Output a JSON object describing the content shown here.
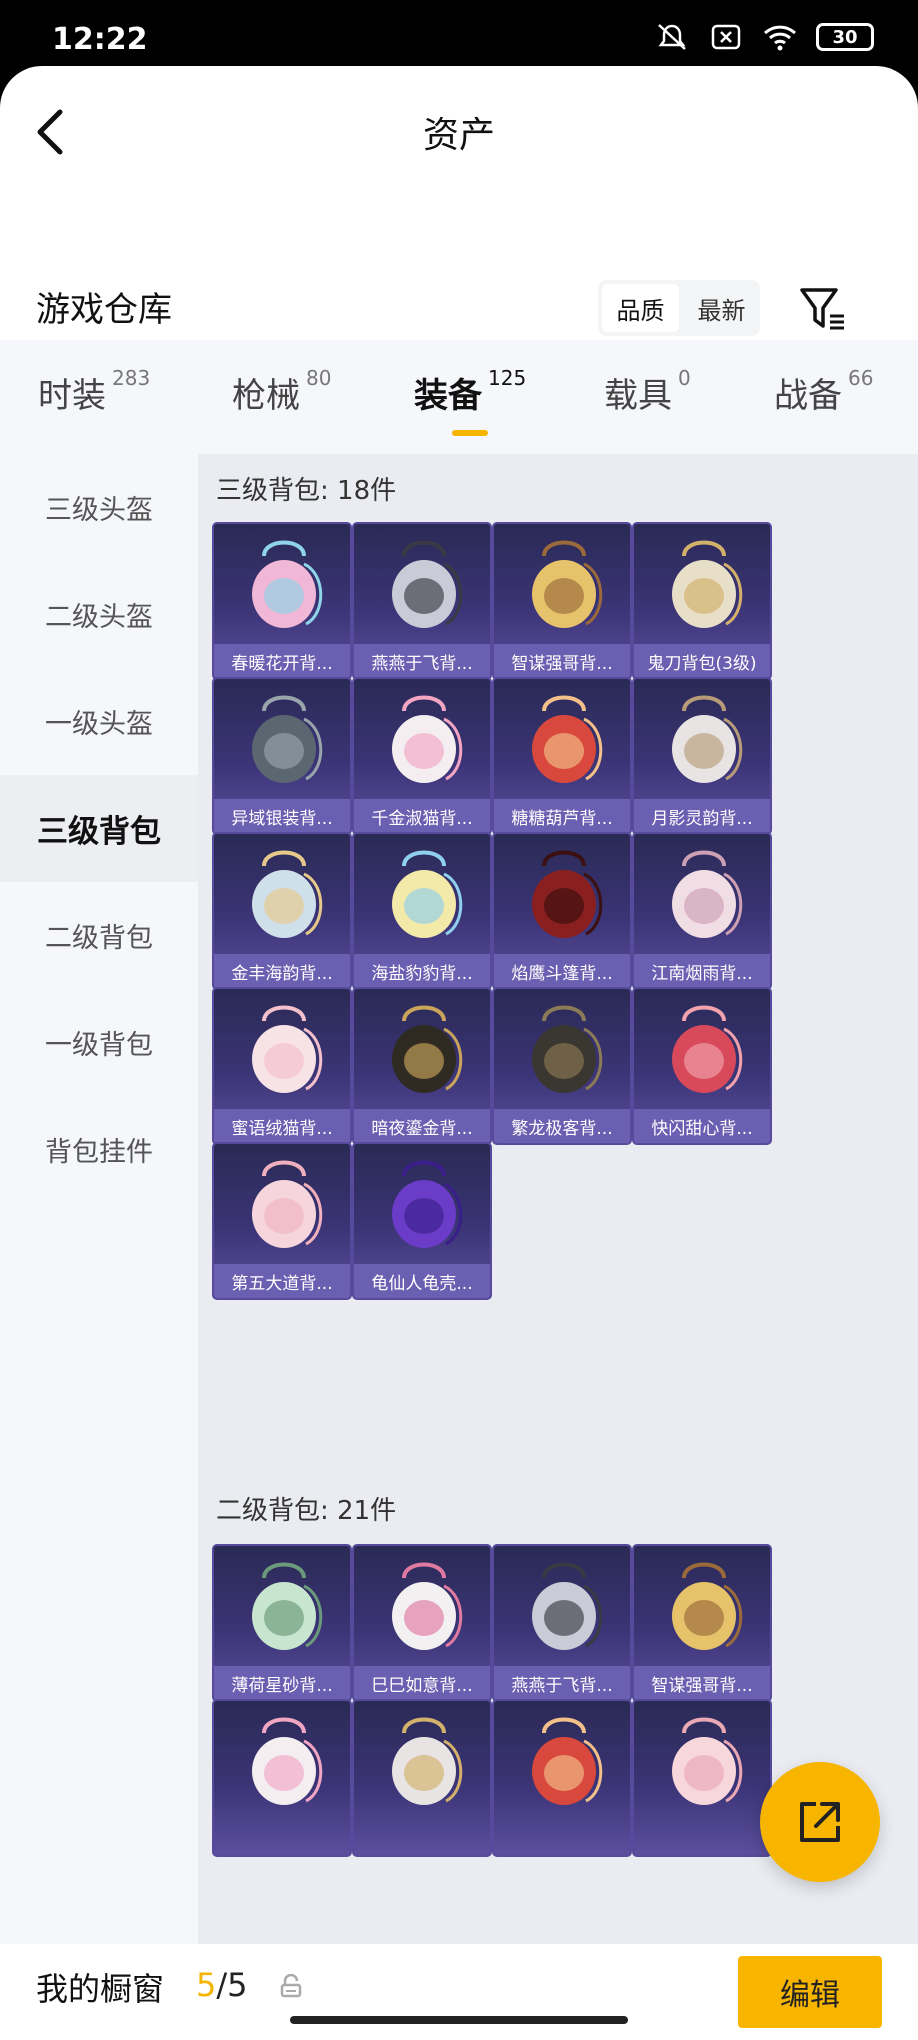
{
  "status": {
    "time": "12:22",
    "battery": "30"
  },
  "header": {
    "title": "资产"
  },
  "warehouse": {
    "title": "游戏仓库",
    "sort_options": [
      "品质",
      "最新"
    ]
  },
  "tabs": [
    {
      "label": "时装",
      "count": "283"
    },
    {
      "label": "枪械",
      "count": "80"
    },
    {
      "label": "装备",
      "count": "125"
    },
    {
      "label": "载具",
      "count": "0"
    },
    {
      "label": "战备",
      "count": "66"
    }
  ],
  "sidebar": [
    "三级头盔",
    "二级头盔",
    "一级头盔",
    "三级背包",
    "二级背包",
    "一级背包",
    "背包挂件"
  ],
  "groups": [
    {
      "title": "三级背包: 18件",
      "items": [
        "春暖花开背...",
        "燕燕于飞背...",
        "智谋强哥背...",
        "鬼刀背包(3级)",
        "异域银装背...",
        "千金淑猫背...",
        "糖糖葫芦背...",
        "月影灵韵背...",
        "金丰海韵背...",
        "海盐豹豹背...",
        "焰鹰斗篷背...",
        "江南烟雨背...",
        "蜜语绒猫背...",
        "暗夜鎏金背...",
        "繁龙极客背...",
        "快闪甜心背...",
        "第五大道背...",
        "龟仙人龟壳..."
      ]
    },
    {
      "title": "二级背包: 21件",
      "items": [
        "薄荷星砂背...",
        "巳巳如意背...",
        "燕燕于飞背...",
        "智谋强哥背...",
        "",
        "",
        "",
        ""
      ]
    }
  ],
  "bottom": {
    "label": "我的橱窗",
    "current": "5",
    "total": "/5",
    "edit": "编辑"
  },
  "colors": {
    "accent": "#f7b500",
    "card": "#3b3476"
  }
}
